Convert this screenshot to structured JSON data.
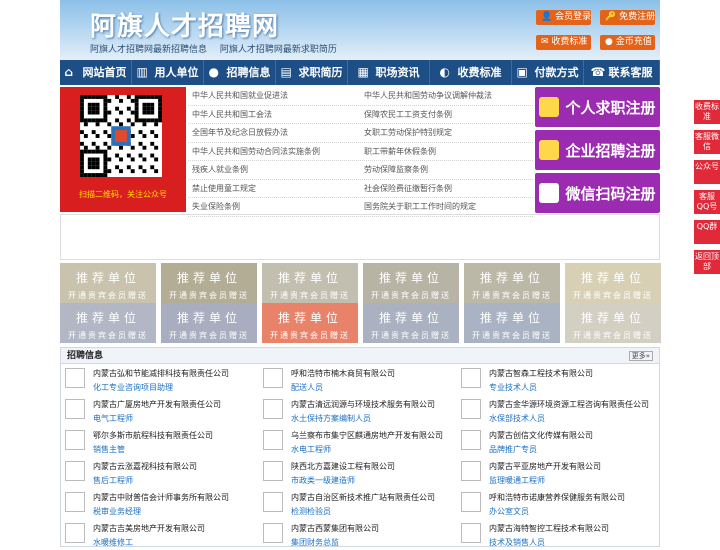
{
  "header": {
    "title": "阿旗人才招聘网",
    "subtitle_links": [
      "阿旗人才招聘网最新招聘信息",
      "阿旗人才招聘网最新求职简历"
    ],
    "buttons": {
      "login": "会员登录",
      "register": "免费注册",
      "fees": "收费标准",
      "recharge": "金币充值"
    }
  },
  "nav": [
    {
      "label": "网站首页",
      "icon": "home-icon"
    },
    {
      "label": "用人单位",
      "icon": "building-icon"
    },
    {
      "label": "招聘信息",
      "icon": "chat-icon"
    },
    {
      "label": "求职简历",
      "icon": "resume-icon"
    },
    {
      "label": "职场资讯",
      "icon": "news-icon"
    },
    {
      "label": "收费标准",
      "icon": "chart-icon"
    },
    {
      "label": "付款方式",
      "icon": "payment-icon"
    },
    {
      "label": "联系客服",
      "icon": "phone-icon"
    }
  ],
  "promo": {
    "caption": "扫描二维码，关注公众号"
  },
  "law_links": [
    [
      "中华人民共和国就业促进法",
      "中华人民共和国劳动争议调解仲裁法"
    ],
    [
      "中华人民共和国工会法",
      "保障农民工工资支付条例"
    ],
    [
      "全国年节及纪念日放假办法",
      "女职工劳动保护特别规定"
    ],
    [
      "中华人民共和国劳动合同法实施条例",
      "职工带薪年休假条例"
    ],
    [
      "残疾人就业条例",
      "劳动保障监察条例"
    ],
    [
      "禁止使用童工规定",
      "社会保险费征缴暂行条例"
    ],
    [
      "失业保险条例",
      "国务院关于职工工作时间的规定"
    ]
  ],
  "register": {
    "personal": "个人求职注册",
    "company": "企业招聘注册",
    "wechat": "微信扫码注册"
  },
  "recommend": {
    "title": "推荐单位",
    "sub": "开通贵宾会员赠送",
    "colors": [
      "#c9c3ae",
      "#b4ad95",
      "#c3bfb0",
      "#b8b4a5",
      "#bcb8a8",
      "#d8d0b5",
      "#b1b7c5",
      "#a8aec0",
      "#e8836a",
      "#aab2c2",
      "#a9b3c4",
      "#d3cfc2"
    ]
  },
  "jobs": {
    "header": "招聘信息",
    "more": "更多»",
    "items": [
      [
        "内蒙古弘和节能减排科技有限责任公司",
        "化工专业咨询项目助理"
      ],
      [
        "呼和浩特市楠木商贸有限公司",
        "配送人员"
      ],
      [
        "内蒙古智森工程技术有限公司",
        "专业技术人员"
      ],
      [
        "内蒙古广厦房地产开发有限责任公司",
        "电气工程师"
      ],
      [
        "内蒙古清远润源与环境技术服务有限公司",
        "水土保持方案编制人员"
      ],
      [
        "内蒙古金华源环境资源工程咨询有限责任公司",
        "水保部技术人员"
      ],
      [
        "鄂尔多斯市航程科技有限责任公司",
        "销售主管"
      ],
      [
        "乌兰察布市集宁区麒通房地产开发有限公司",
        "水电工程师"
      ],
      [
        "内蒙古创信文化传媒有限公司",
        "品牌推广专员"
      ],
      [
        "内蒙古云涨嘉视科技有限公司",
        "售后工程师"
      ],
      [
        "陕西北方嘉建设工程有限公司",
        "市政类一级建造师"
      ],
      [
        "内蒙古平亚房地产开发有限公司",
        "监理暖通工程师"
      ],
      [
        "内蒙古中财普信会计师事务所有限公司",
        "税审业务经理"
      ],
      [
        "内蒙古自治区新技术推广站有限责任公司",
        "检测检验员"
      ],
      [
        "呼和浩特市诺康营养保健服务有限公司",
        "办公室文员"
      ],
      [
        "内蒙古吉美房地产开发有限公司",
        "水暖维修工"
      ],
      [
        "内蒙古西蒙集团有限公司",
        "集团财务总监"
      ],
      [
        "内蒙古海特智控工程技术有限公司",
        "技术及销售人员"
      ]
    ]
  },
  "sidebar": [
    "收费标准",
    "客服微信",
    "公众号",
    "客服QQ号",
    "QQ群",
    "返回顶部"
  ]
}
